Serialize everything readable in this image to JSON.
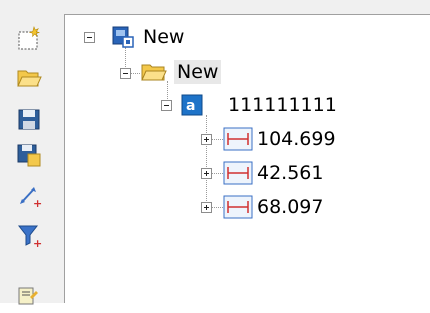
{
  "toolbar": {
    "buttons": [
      {
        "icon": "new-document-icon"
      },
      {
        "icon": "open-folder-icon"
      },
      {
        "icon": "save-icon"
      },
      {
        "icon": "save-as-icon"
      },
      {
        "icon": "add-measurement-icon"
      },
      {
        "icon": "add-filter-icon"
      },
      {
        "icon": "edit-list-icon"
      }
    ]
  },
  "tree": {
    "root": {
      "label": "New",
      "icon": "project-icon"
    },
    "folder": {
      "label": "New",
      "icon": "folder-icon"
    },
    "item": {
      "label": "111111111",
      "icon": "item-a-icon"
    },
    "measurements": [
      {
        "label": "104.699",
        "icon": "dimension-icon"
      },
      {
        "label": "42.561",
        "icon": "dimension-icon"
      },
      {
        "label": "68.097",
        "icon": "dimension-icon"
      }
    ]
  },
  "colors": {
    "selection": "#e8e8e8",
    "toolbar": "#f0f0f0",
    "accent": "#1e73c8"
  }
}
